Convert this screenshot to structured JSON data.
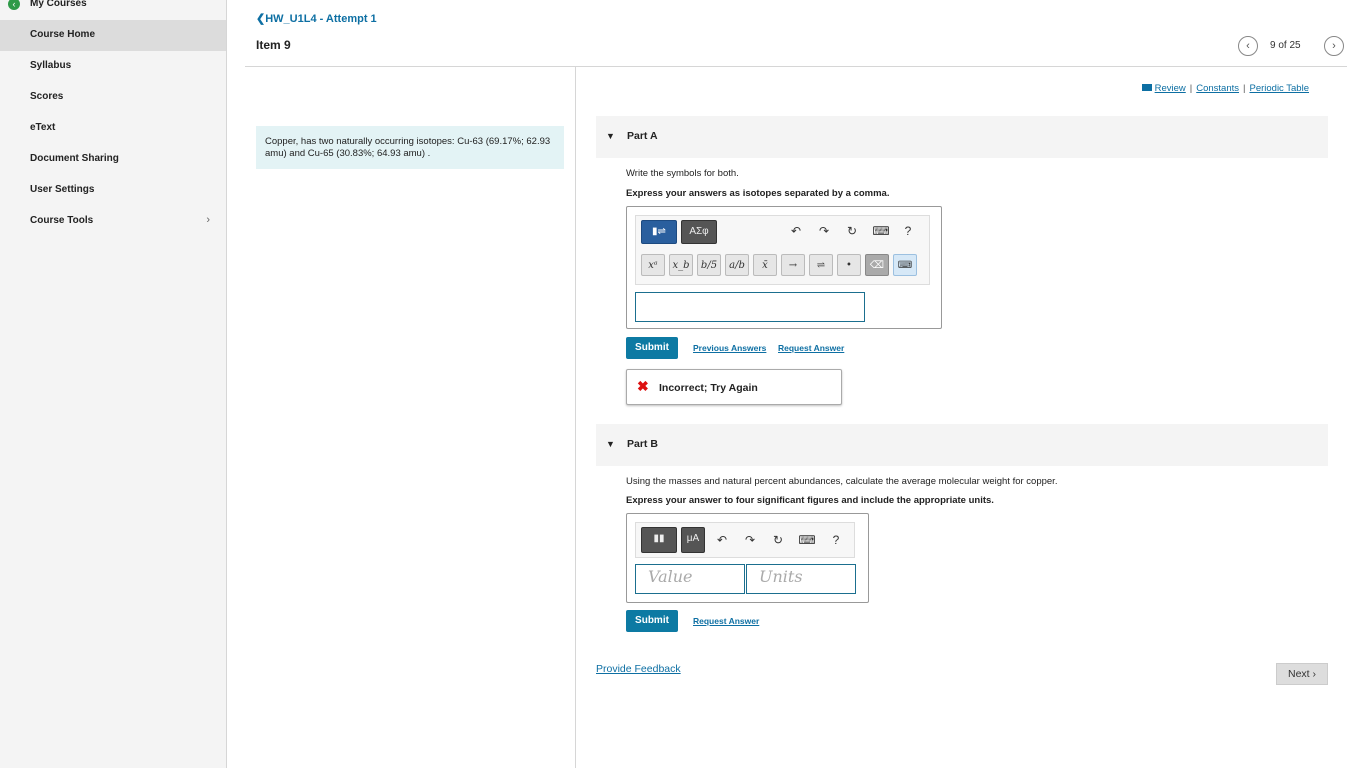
{
  "sidebar": {
    "top_label": "My Courses",
    "items": [
      {
        "label": "Course Home"
      },
      {
        "label": "Syllabus"
      },
      {
        "label": "Scores"
      },
      {
        "label": "eText"
      },
      {
        "label": "Document Sharing"
      },
      {
        "label": "User Settings"
      },
      {
        "label": "Course Tools"
      }
    ]
  },
  "header": {
    "back_label": "HW_U1L4 - Attempt 1",
    "item_title": "Item 9",
    "pager_text": "9 of 25"
  },
  "intro": {
    "text": "Copper, has two naturally occurring isotopes: Cu-63 (69.17%; 62.93 amu) and Cu-65 (30.83%; 64.93 amu) ."
  },
  "toplinks": {
    "review": "Review",
    "constants": "Constants",
    "periodic": "Periodic Table",
    "sep": "|"
  },
  "partA": {
    "title": "Part A",
    "question": "Write the symbols for both.",
    "instruction": "Express your answers as isotopes separated by a comma.",
    "tool_greek": "ΑΣφ",
    "keys": [
      "xᵃ",
      "x_b",
      "b/5",
      "a/b",
      "x̄",
      "→",
      "⇌",
      "•"
    ],
    "help": "?",
    "submit": "Submit",
    "previous_answers": "Previous Answers",
    "request_answer": "Request Answer",
    "feedback": "Incorrect; Try Again"
  },
  "partB": {
    "title": "Part B",
    "question": "Using the masses and natural percent abundances, calculate the average molecular weight for copper.",
    "instruction": "Express your answer to four significant figures and include the appropriate units.",
    "tool_units": "μA",
    "help": "?",
    "value_placeholder": "Value",
    "units_placeholder": "Units",
    "submit": "Submit",
    "request_answer": "Request Answer"
  },
  "footer": {
    "provide_feedback": "Provide Feedback",
    "next": "Next"
  }
}
